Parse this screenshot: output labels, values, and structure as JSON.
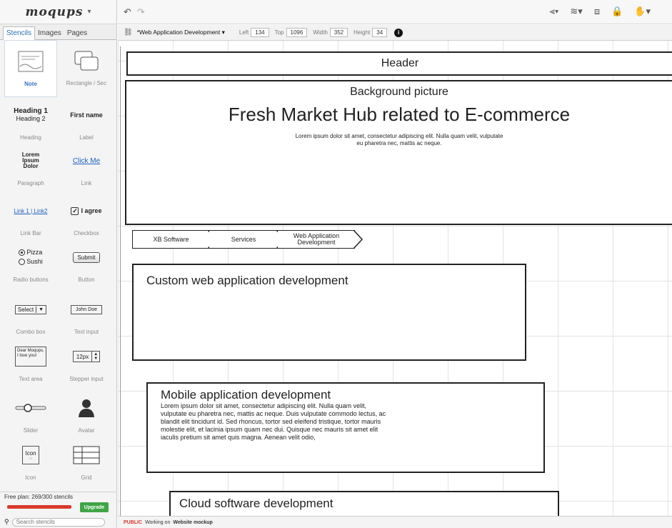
{
  "app": {
    "logo": "moqups",
    "tabs": [
      "Stencils",
      "Images",
      "Pages"
    ],
    "active_tab": 0
  },
  "stencils": [
    {
      "caption": "Note",
      "selected": true
    },
    {
      "caption": "Rectangle / Sec"
    },
    {
      "caption": "Heading",
      "heading1": "Heading 1",
      "heading2": "Heading 2"
    },
    {
      "caption": "Label",
      "text": "First name"
    },
    {
      "caption": "Paragraph",
      "text": "Lorem Ipsum Dolor"
    },
    {
      "caption": "Link",
      "text": "Click Me"
    },
    {
      "caption": "Link Bar",
      "text": "Link 1 | Link2"
    },
    {
      "caption": "Checkbox",
      "text": "I agree"
    },
    {
      "caption": "Radio buttons",
      "option1": "Pizza",
      "option2": "Sushi"
    },
    {
      "caption": "Button",
      "text": "Submit"
    },
    {
      "caption": "Combo box",
      "text": "Select"
    },
    {
      "caption": "Text input",
      "text": "John Doe"
    },
    {
      "caption": "Text area",
      "text": "Dear Moqups, I love you!"
    },
    {
      "caption": "Stepper input",
      "text": "12px"
    },
    {
      "caption": "Slider"
    },
    {
      "caption": "Avatar"
    },
    {
      "caption": "Icon",
      "text": "Icon"
    },
    {
      "caption": "Grid"
    }
  ],
  "plan": {
    "text": "Free plan: 269/300 stencils",
    "usage_fraction": 0.9,
    "upgrade_label": "Upgrade"
  },
  "search": {
    "placeholder": "Search stencils"
  },
  "properties": {
    "page_name": "*Web Application Development",
    "left_label": "Left",
    "left": "134",
    "top_label": "Top",
    "top": "1096",
    "width_label": "Width",
    "width": "352",
    "height_label": "Height",
    "height": "34"
  },
  "canvas": {
    "header": "Header",
    "bg_label": "Background picture",
    "hero_title": "Fresh Market Hub related to E-commerce",
    "hero_body": "Lorem ipsum dolor sit amet, consectetur adipiscing elit. Nulla quam velit, vulputate eu pharetra nec, mattis ac neque.",
    "breadcrumbs": [
      "XB Software",
      "Services",
      "Web Application Development"
    ],
    "section1_title": "Custom web application development",
    "section2_title": "Mobile application development",
    "section2_body": "Lorem ipsum dolor sit amet, consectetur adipiscing elit. Nulla quam velit, vulputate eu pharetra nec, mattis ac neque. Duis vulputate commodo lectus, ac blandit elit tincidunt id. Sed rhoncus, tortor sed eleifend tristique, tortor mauris molestie elit, et lacinia ipsum quam nec dui. Quisque nec mauris sit amet elit iaculis pretium sit amet quis magna. Aenean velit odio,",
    "section3_title": "Cloud software development"
  },
  "status": {
    "badge": "PUBLIC",
    "text": "Working on",
    "project": "Website mockup"
  },
  "colors": {
    "accent": "#2a6fb5",
    "usage_bar": "#d93a2b",
    "upgrade": "#3fa546"
  }
}
